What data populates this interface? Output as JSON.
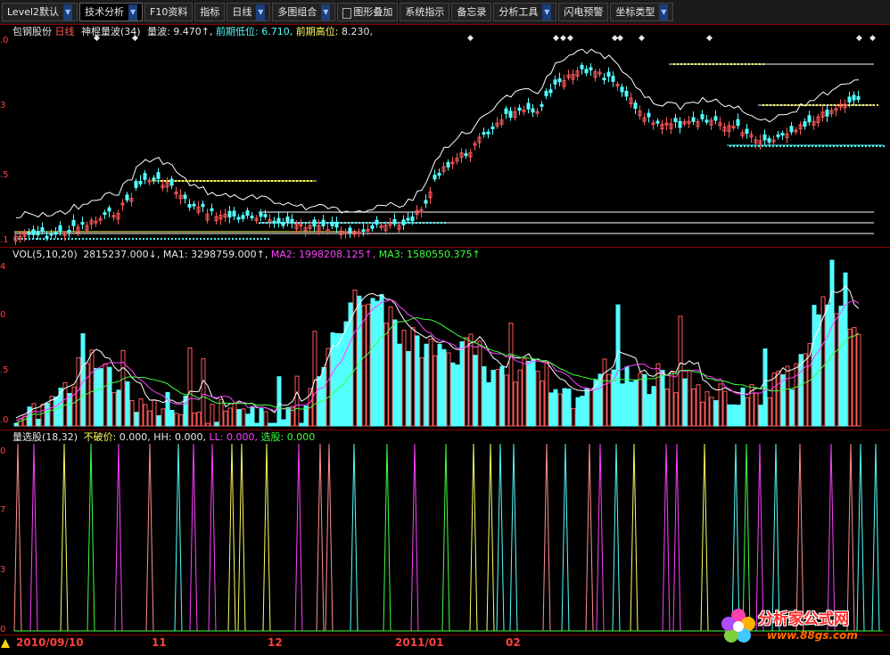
{
  "toolbar": {
    "items": [
      {
        "label": "Level2默认",
        "caret": true
      },
      {
        "label": "技术分析",
        "caret": true,
        "active": true
      },
      {
        "label": "F10资料",
        "caret": false
      },
      {
        "label": "指标",
        "caret": false
      },
      {
        "label": "日线",
        "caret": true
      },
      {
        "label": "多图组合",
        "caret": true
      },
      {
        "label": "图形叠加",
        "caret": false,
        "lock": true
      },
      {
        "label": "系统指示",
        "caret": false
      },
      {
        "label": "备忘录",
        "caret": false
      },
      {
        "label": "分析工具",
        "caret": true
      },
      {
        "label": "闪电预警",
        "caret": false
      },
      {
        "label": "坐标类型",
        "caret": true
      }
    ]
  },
  "price_panel": {
    "stock_name": "包钢股份",
    "period": "日线",
    "indicator": "神棍量波(34)",
    "field1_label": "量波:",
    "field1_value": "9.470↑,",
    "field2_label": "前期低位:",
    "field2_value": "6.710,",
    "field3_label": "前期高位:",
    "field3_value": "8.230,",
    "y_ticks": [
      ".0",
      "3",
      ".5",
      ".1"
    ]
  },
  "vol_panel": {
    "name": "VOL(5,10,20)",
    "vol_value": "2815237.000↓,",
    "ma1_label": "MA1:",
    "ma1_value": "3298759.000↑,",
    "ma2_label": "MA2:",
    "ma2_value": "1998208.125↑,",
    "ma3_label": "MA3:",
    "ma3_value": "1580550.375↑",
    "y_ticks": [
      "4",
      "0",
      ".5",
      ".0"
    ]
  },
  "select_panel": {
    "name": "量选股(18,32)",
    "f1_label": "不破价:",
    "f1_value": "0.000,",
    "f2_label": "HH:",
    "f2_value": "0.000,",
    "f3_label": "LL:",
    "f3_value": "0.000,",
    "f4_label": "选股:",
    "f4_value": "0.000",
    "y_ticks": [
      "0",
      "7",
      "3",
      "0"
    ]
  },
  "x_axis": {
    "labels": [
      "2010/09/10",
      "11",
      "12",
      "2011/01",
      "02"
    ]
  },
  "watermark": {
    "title": "分析家公式网",
    "url": "www.88gs.com"
  },
  "colors": {
    "up": "#ff5a5a",
    "down": "#54ffff",
    "ma1": "#ffffff",
    "ma2": "#ff40ff",
    "ma3": "#40ff40",
    "yellow_line": "#ffff60",
    "axis": "#ff4040"
  }
}
